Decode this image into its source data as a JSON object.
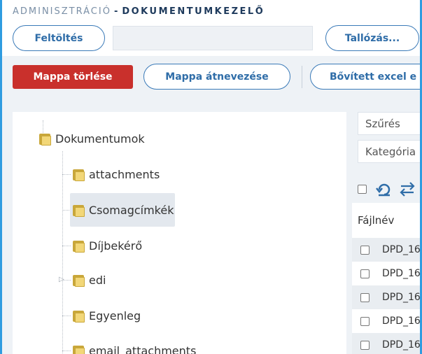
{
  "header": {
    "section": "ADMINISZTRÁCIÓ",
    "separator": "-",
    "page": "DOKUMENTUMKEZELŐ"
  },
  "upload": {
    "upload_label": "Feltöltés",
    "browse_label": "Tallózás..."
  },
  "toolbar": {
    "delete_folder": "Mappa törlése",
    "rename_folder": "Mappa átnevezése",
    "excel_export": "Bővített excel e"
  },
  "tree": {
    "root": "Dokumentumok",
    "children": [
      "attachments",
      "Csomagcímkék",
      "Díjbekérő",
      "edi",
      "Egyenleg",
      "email_attachments"
    ],
    "selected": "Csomagcímkék"
  },
  "filters": {
    "filter_label": "Szűrés",
    "category_label": "Kategória"
  },
  "file_table": {
    "column_filename": "Fájlnév",
    "rows": [
      "DPD_16",
      "DPD_16",
      "DPD_16",
      "DPD_16",
      "DPD_16"
    ]
  },
  "colors": {
    "accent": "#2f9ce0",
    "danger": "#c9302c",
    "outline": "#3a7ab8",
    "folder": "#f2d778"
  },
  "icons": [
    "folder-icon",
    "refresh-icon",
    "swap-icon",
    "checkbox-icon",
    "expand-arrow-icon"
  ]
}
